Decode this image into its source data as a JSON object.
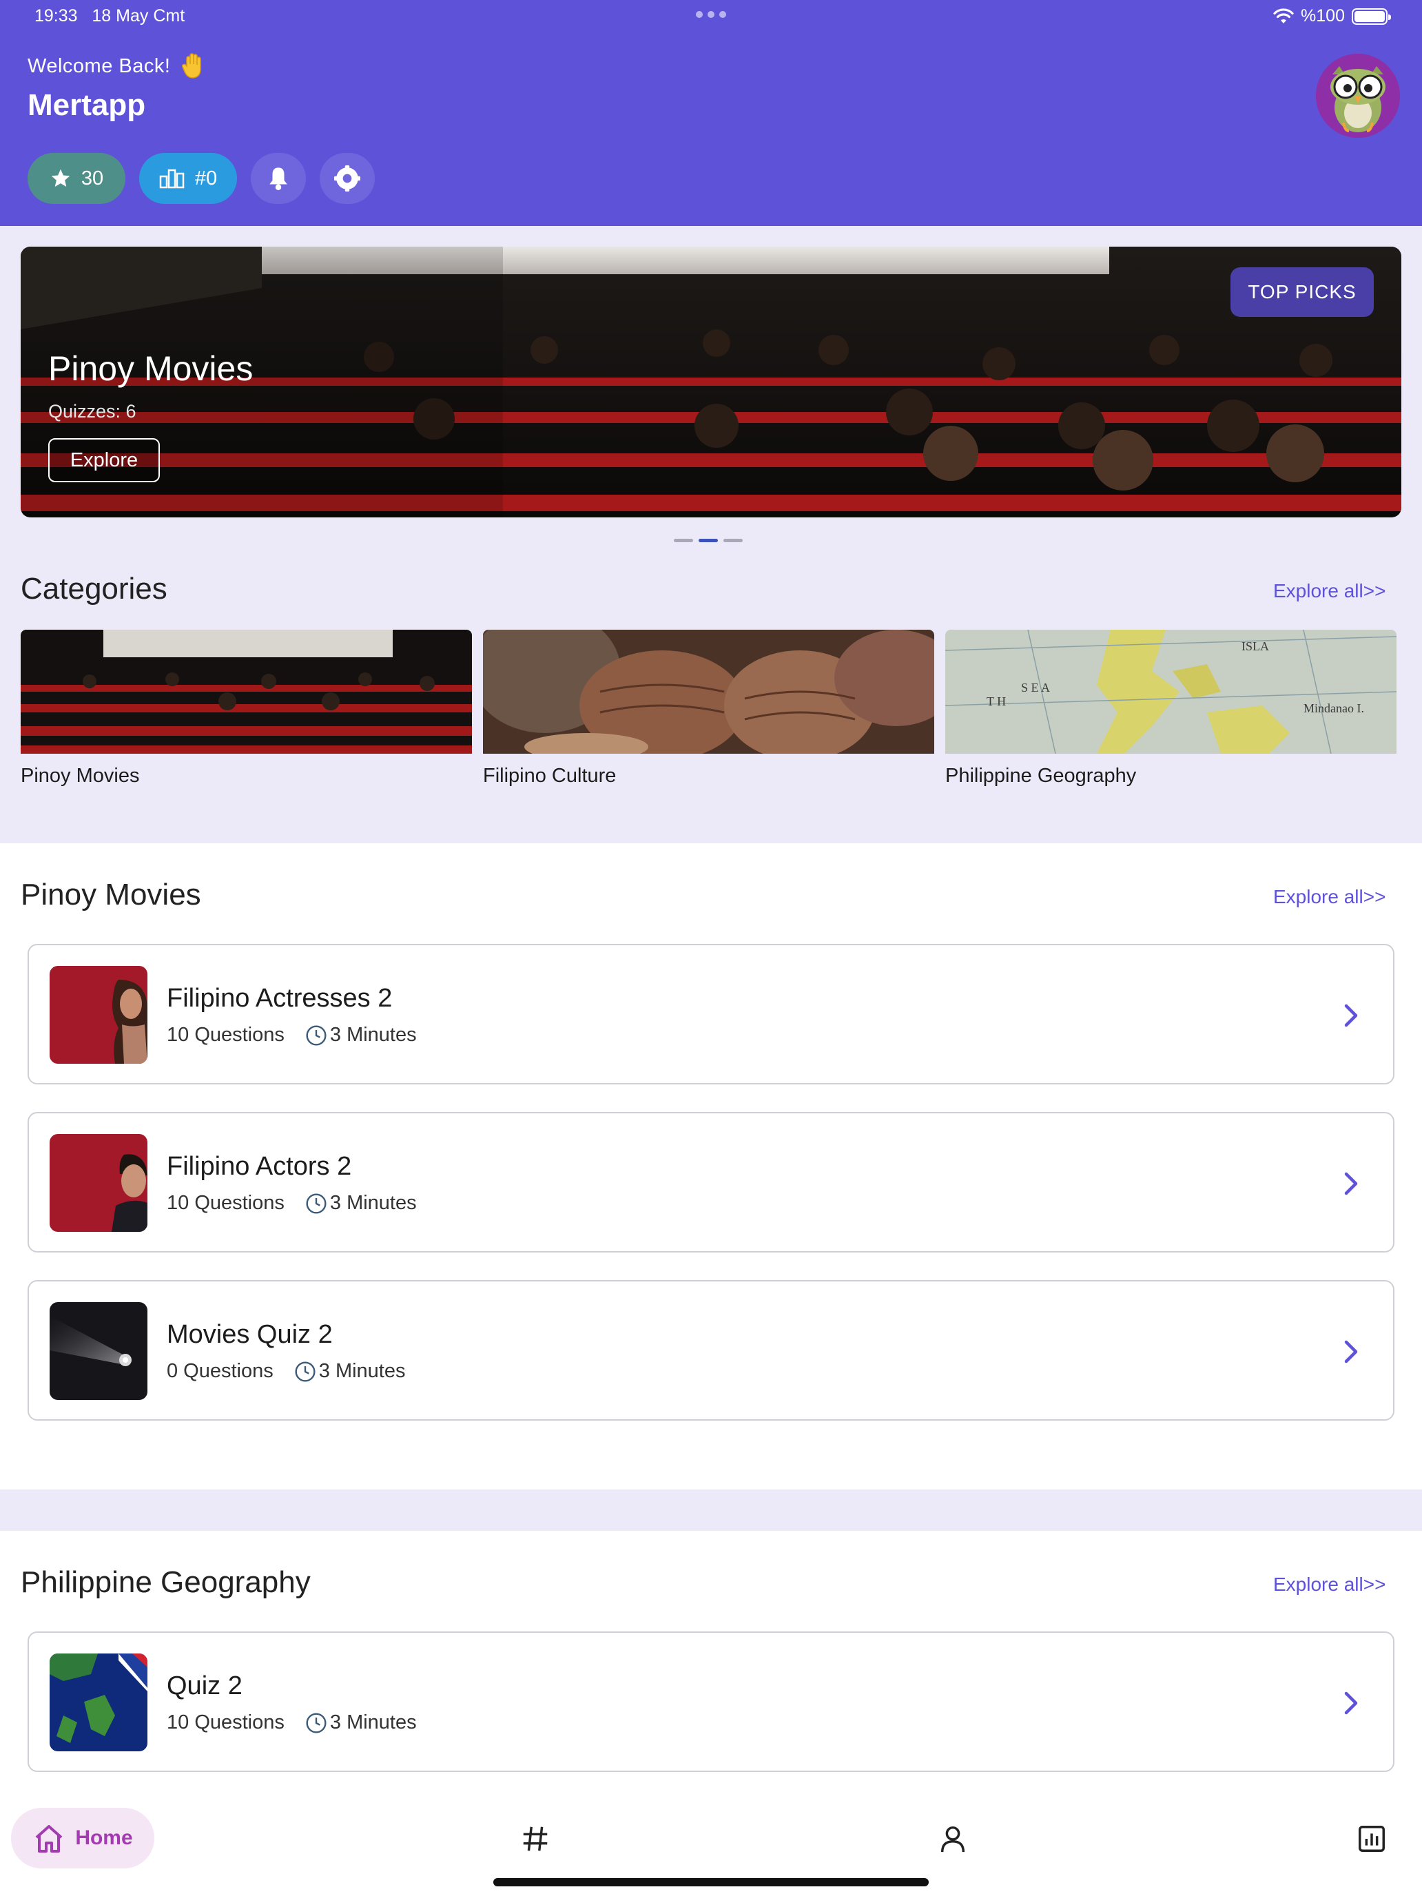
{
  "status_bar": {
    "time": "19:33",
    "date": "18 May Cmt",
    "battery": "%100"
  },
  "header": {
    "welcome": "Welcome Back!",
    "app_name": "Mertapp",
    "score": "30",
    "rank": "#0"
  },
  "banner": {
    "title": "Pinoy Movies",
    "subtitle": "Quizzes: 6",
    "button": "Explore",
    "tag": "TOP PICKS",
    "pages": 3,
    "active_page": 1
  },
  "categories": {
    "title": "Categories",
    "explore": "Explore all>>",
    "items": [
      {
        "label": "Pinoy Movies"
      },
      {
        "label": "Filipino Culture"
      },
      {
        "label": "Philippine Geography"
      }
    ]
  },
  "pinoy_movies": {
    "title": "Pinoy Movies",
    "explore": "Explore all>>",
    "quizzes": [
      {
        "title": "Filipino Actresses 2",
        "questions": "10 Questions",
        "minutes": "3 Minutes"
      },
      {
        "title": "Filipino Actors 2",
        "questions": "10 Questions",
        "minutes": "3 Minutes"
      },
      {
        "title": "Movies Quiz 2",
        "questions": "0 Questions",
        "minutes": "3 Minutes"
      }
    ]
  },
  "philippine_geography": {
    "title": "Philippine Geography",
    "explore": "Explore all>>",
    "quizzes": [
      {
        "title": "Quiz 2",
        "questions": "10 Questions",
        "minutes": "3 Minutes"
      }
    ]
  },
  "nav": {
    "home": "Home"
  },
  "colors": {
    "primary": "#5e52d9",
    "score_chip": "#4f8f8a",
    "rank_chip": "#2b9be0",
    "home_accent": "#a33bb0"
  }
}
